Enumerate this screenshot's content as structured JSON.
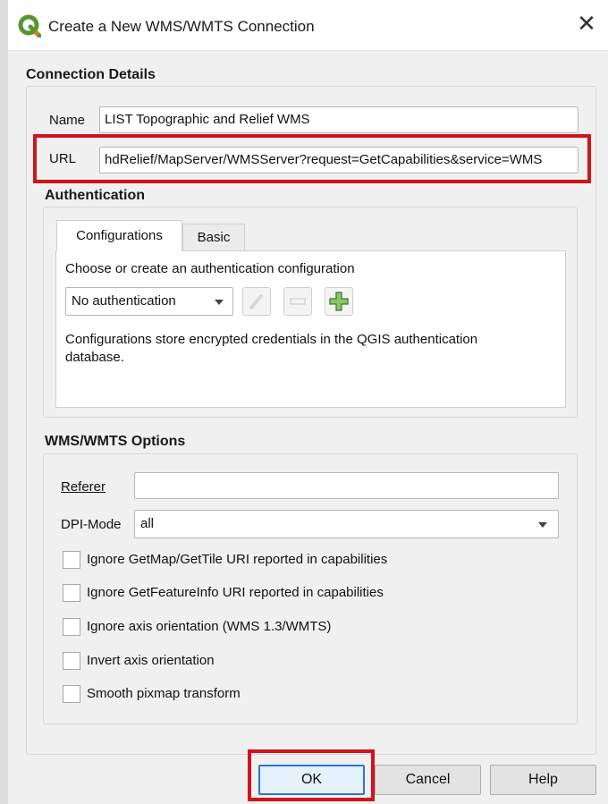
{
  "window": {
    "title": "Create a New WMS/WMTS Connection",
    "close_label": "✕",
    "app_icon": "qgis-logo-icon"
  },
  "connection": {
    "section_title": "Connection Details",
    "name_label": "Name",
    "name_value": "LIST Topographic and Relief WMS",
    "url_label": "URL",
    "url_value": "hdRelief/MapServer/WMSServer?request=GetCapabilities&service=WMS"
  },
  "authentication": {
    "section_title": "Authentication",
    "tabs": [
      {
        "label": "Configurations",
        "active": true
      },
      {
        "label": "Basic",
        "active": false
      }
    ],
    "choose_text": "Choose or create an authentication configuration",
    "config_select": "No authentication",
    "info_line1": "Configurations store encrypted credentials in the QGIS authentication",
    "info_line2": "database.",
    "icons": [
      "edit-pencil-icon",
      "remove-icon",
      "add-plus-icon"
    ]
  },
  "wms_options": {
    "section_title": "WMS/WMTS Options",
    "referer_label": "Referer",
    "referer_value": "",
    "dpi_label": "DPI-Mode",
    "dpi_value": "all",
    "checkboxes": [
      {
        "label": "Ignore GetMap/GetTile URI reported in capabilities",
        "checked": false
      },
      {
        "label": "Ignore GetFeatureInfo URI reported in capabilities",
        "checked": false
      },
      {
        "label": "Ignore axis orientation (WMS 1.3/WMTS)",
        "checked": false
      },
      {
        "label": "Invert axis orientation",
        "checked": false
      },
      {
        "label": "Smooth pixmap transform",
        "checked": false
      }
    ]
  },
  "buttons": {
    "ok": "OK",
    "cancel": "Cancel",
    "help": "Help"
  },
  "colors": {
    "highlight": "#d1131c",
    "qgis_green": "#589632",
    "qgis_yellow": "#ee7913"
  }
}
